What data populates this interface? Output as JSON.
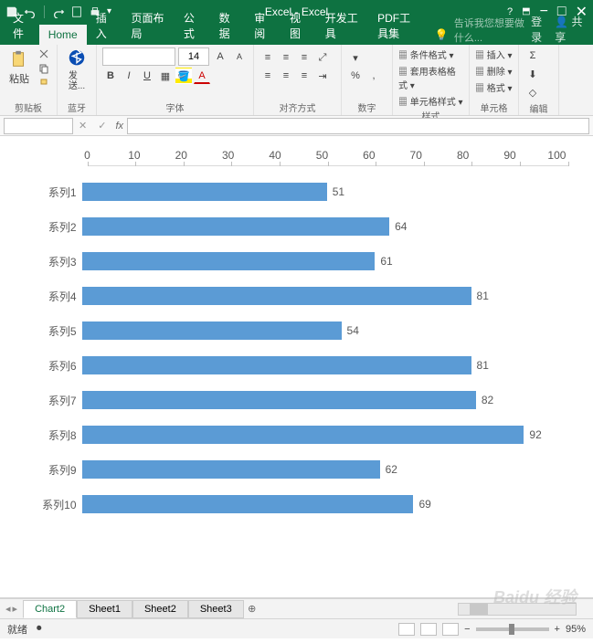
{
  "app": {
    "title": "Excel - Excel"
  },
  "qat": {
    "save": "save",
    "undo": "undo",
    "redo": "redo",
    "new": "new",
    "print": "print"
  },
  "win": {
    "min": "−",
    "max": "□",
    "close": "✕",
    "ribbon_min": "▲"
  },
  "tabs": {
    "file": "文件",
    "home": "Home",
    "insert": "插入",
    "layout": "页面布局",
    "formulas": "公式",
    "data": "数据",
    "review": "审阅",
    "view": "视图",
    "dev": "开发工具",
    "pdf": "PDF工具集",
    "tellme": "告诉我您想要做什么...",
    "login": "登录",
    "share": "共享"
  },
  "ribbon": {
    "clipboard": {
      "paste": "粘贴",
      "label": "剪贴板"
    },
    "bluetooth": {
      "line1": "发",
      "line2": "送...",
      "line3": "蓝牙"
    },
    "font": {
      "name": "",
      "size": "14",
      "label": "字体"
    },
    "align": {
      "label": "对齐方式"
    },
    "number": {
      "label": "数字"
    },
    "styles": {
      "cond": "条件格式",
      "table": "套用表格格式",
      "cell": "单元格样式",
      "label": "样式"
    },
    "cells": {
      "insert": "插入",
      "delete": "删除",
      "format": "格式",
      "label": "单元格"
    },
    "editing": {
      "label": "编辑"
    }
  },
  "formula": {
    "namebox": "",
    "fx": "fx"
  },
  "chart_data": {
    "type": "bar",
    "orientation": "horizontal",
    "categories": [
      "系列1",
      "系列2",
      "系列3",
      "系列4",
      "系列5",
      "系列6",
      "系列7",
      "系列8",
      "系列9",
      "系列10"
    ],
    "values": [
      51,
      64,
      61,
      81,
      54,
      81,
      82,
      92,
      62,
      69
    ],
    "xlim": [
      0,
      100
    ],
    "xticks": [
      0,
      10,
      20,
      30,
      40,
      50,
      60,
      70,
      80,
      90,
      100
    ],
    "bar_color": "#5b9bd5"
  },
  "sheets": {
    "active": "Chart2",
    "tabs": [
      "Chart2",
      "Sheet1",
      "Sheet2",
      "Sheet3"
    ]
  },
  "status": {
    "ready": "就绪",
    "rec": "",
    "zoom": "95%",
    "plus": "+",
    "minus": "−"
  },
  "watermark": "Baidu 经验"
}
